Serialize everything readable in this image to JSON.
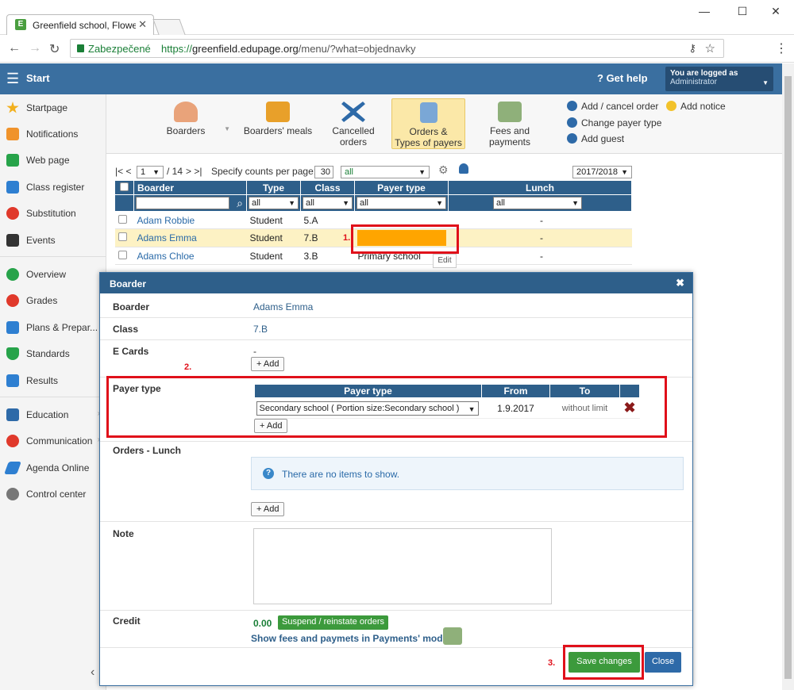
{
  "browser": {
    "tab_title": "Greenfield school, Flower",
    "tab_favicon": "E",
    "secure_label": "Zabezpečené",
    "url_scheme": "https://",
    "url_host": "greenfield.edupage.org",
    "url_path": "/menu/?what=objednavky"
  },
  "header": {
    "start_label": "Start",
    "help_label": "Get help",
    "logged_as": "You are logged as",
    "user": "Administrator"
  },
  "sidebar": {
    "items": [
      {
        "label": "Startpage",
        "icon": "star-icon",
        "color": "#f2b01e"
      },
      {
        "label": "Notifications",
        "icon": "envelope-icon",
        "color": "#f0932b"
      },
      {
        "label": "Web page",
        "icon": "home-icon",
        "color": "#27a34a"
      },
      {
        "label": "Class register",
        "icon": "book-icon",
        "color": "#2e7fd1"
      },
      {
        "label": "Substitution",
        "icon": "person-icon",
        "color": "#e0392b"
      },
      {
        "label": "Events",
        "icon": "calendar-icon",
        "color": "#333333"
      },
      {
        "label": "Overview",
        "icon": "check-circle-icon",
        "color": "#27a34a"
      },
      {
        "label": "Grades",
        "icon": "grades-icon",
        "color": "#e0392b"
      },
      {
        "label": "Plans & Prepar...",
        "icon": "briefcase-icon",
        "color": "#2e7fd1"
      },
      {
        "label": "Standards",
        "icon": "shield-icon",
        "color": "#27a34a"
      },
      {
        "label": "Results",
        "icon": "bar-chart-icon",
        "color": "#2e7fd1"
      },
      {
        "label": "Education",
        "icon": "book-open-icon",
        "color": "#2e6aa8"
      },
      {
        "label": "Communication",
        "icon": "chat-icon",
        "color": "#e0392b"
      },
      {
        "label": "Agenda Online",
        "icon": "pen-icon",
        "color": "#2e7fd1"
      },
      {
        "label": "Control center",
        "icon": "gear-icon",
        "color": "#777777"
      }
    ]
  },
  "toolbar": {
    "boarders": "Boarders",
    "meals": "Boarders' meals",
    "cancelled": "Cancelled orders",
    "orders_l1": "Orders &",
    "orders_l2": "Types of payers",
    "fees": "Fees and payments",
    "add_cancel_order": "Add / cancel order",
    "change_payer_type": "Change payer type",
    "add_guest": "Add guest",
    "add_notice": "Add notice"
  },
  "grid": {
    "pager_first": "|< <",
    "page_value": "1",
    "page_total": "/ 14",
    "pager_last": "> >|",
    "counts_label": "Specify counts per page:",
    "counts_value": "30",
    "filter_all": "all",
    "year": "2017/2018",
    "columns": [
      "Boarder",
      "Type",
      "Class",
      "Payer type",
      "Lunch"
    ],
    "filters": [
      "all",
      "all",
      "all",
      "all"
    ],
    "rows": [
      {
        "name": "Adam Robbie",
        "type": "Student",
        "class": "5.A",
        "payer": "",
        "lunch": "-"
      },
      {
        "name": "Adams Emma",
        "type": "Student",
        "class": "7.B",
        "payer": "",
        "lunch": "-"
      },
      {
        "name": "Adams Chloe",
        "type": "Student",
        "class": "3.B",
        "payer": "Primary school",
        "lunch": "-"
      }
    ],
    "edit_tooltip": "Edit"
  },
  "modal": {
    "title": "Boarder",
    "boarder_label": "Boarder",
    "boarder_value": "Adams Emma",
    "class_label": "Class",
    "class_value": "7.B",
    "ecards_label": "E Cards",
    "ecards_value": "-",
    "add_label": "+ Add",
    "payer_type_label": "Payer type",
    "payer_columns": [
      "Payer type",
      "From",
      "To"
    ],
    "payer_row": {
      "type": "Secondary school ( Portion size:Secondary school )",
      "from": "1.9.2017",
      "to": "without limit"
    },
    "orders_label": "Orders - Lunch",
    "no_items": "There are no items to show.",
    "note_label": "Note",
    "credit_label": "Credit",
    "credit_value": "0.00",
    "suspend_label": "Suspend / reinstate orders",
    "show_fees": "Show fees and paymets in Payments' module",
    "save_label": "Save changes",
    "close_label": "Close"
  },
  "annotations": {
    "step1": "1.",
    "step2": "2.",
    "step3": "3."
  },
  "colors": {
    "accent": "#2e5f8a",
    "highlight": "#ffa500",
    "annotation": "#e0101a",
    "save": "#3c9a3c"
  }
}
